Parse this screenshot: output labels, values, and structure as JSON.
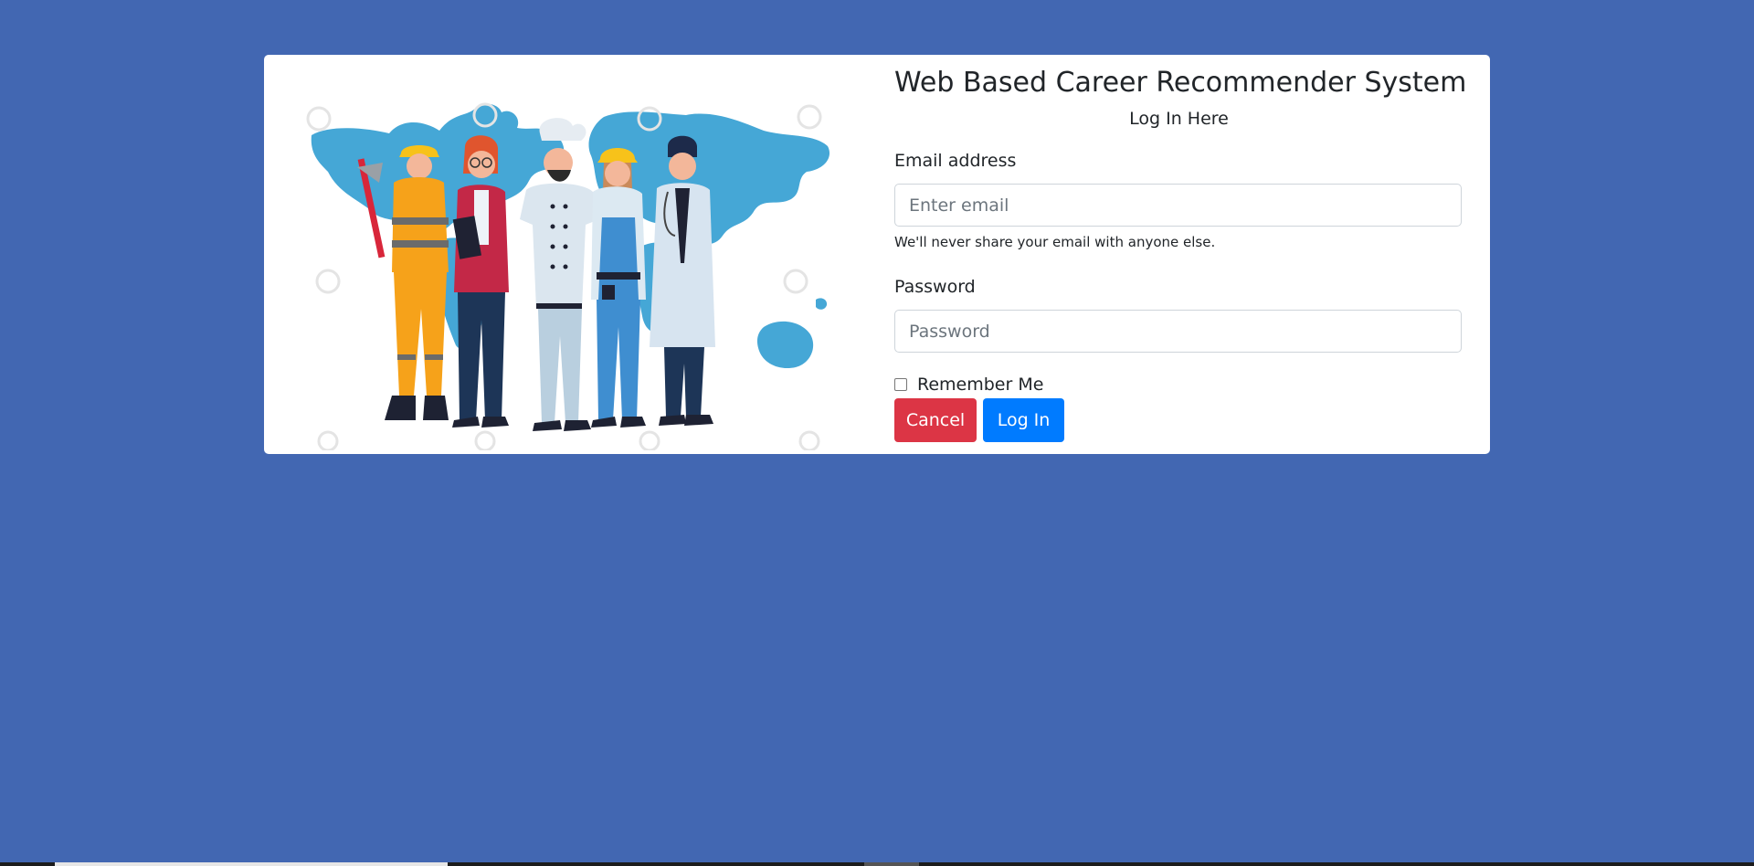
{
  "page": {
    "title": "Web Based Career Recommender System",
    "subtitle": "Log In Here"
  },
  "form": {
    "email_label": "Email address",
    "email_placeholder": "Enter email",
    "email_value": "",
    "email_help": "We'll never share your email with anyone else.",
    "password_label": "Password",
    "password_placeholder": "Password",
    "password_value": "",
    "remember_label": "Remember Me",
    "remember_checked": false,
    "cancel_label": "Cancel",
    "login_label": "Log In"
  },
  "illustration": {
    "icon": "careers-illustration",
    "people": [
      "firefighter",
      "businesswoman",
      "chef",
      "construction-worker",
      "doctor"
    ]
  },
  "colors": {
    "background": "#4267b2",
    "card": "#ffffff",
    "cancel": "#dc3545",
    "login": "#007bff",
    "map": "#4aa8d8"
  }
}
